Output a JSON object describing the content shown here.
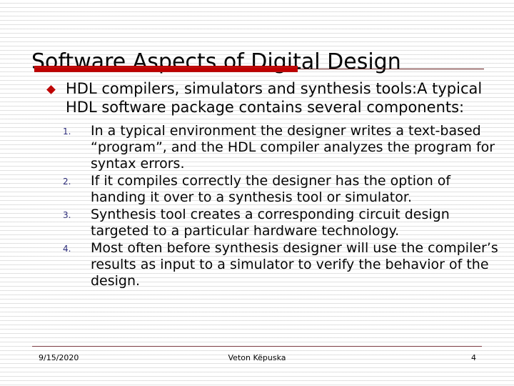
{
  "slide": {
    "title": "Software Aspects of Digital Design",
    "accent_color": "#c00000",
    "rule_color": "#5e1414",
    "number_color": "#2a2a7a",
    "text_color": "#000000",
    "background_color": "#ffffff"
  },
  "content": {
    "bullet_icon": "diamond-bullet",
    "bullet_text": "HDL compilers, simulators and synthesis tools:A typical HDL software package contains several components:",
    "numbered_items": [
      {
        "marker": "1.",
        "text": "In a typical environment the designer writes a text-based “program”, and the HDL compiler analyzes the program for syntax errors."
      },
      {
        "marker": "2.",
        "text": "If it compiles correctly the designer has the option of handing it over to a synthesis tool or simulator."
      },
      {
        "marker": "3.",
        "text": "Synthesis tool creates a corresponding circuit design targeted to a particular hardware technology."
      },
      {
        "marker": "4.",
        "text": "Most often before synthesis designer will use the compiler’s results as input to a simulator to verify the behavior of the design."
      }
    ]
  },
  "footer": {
    "date": "9/15/2020",
    "author": "Veton Këpuska",
    "page_number": "4"
  }
}
